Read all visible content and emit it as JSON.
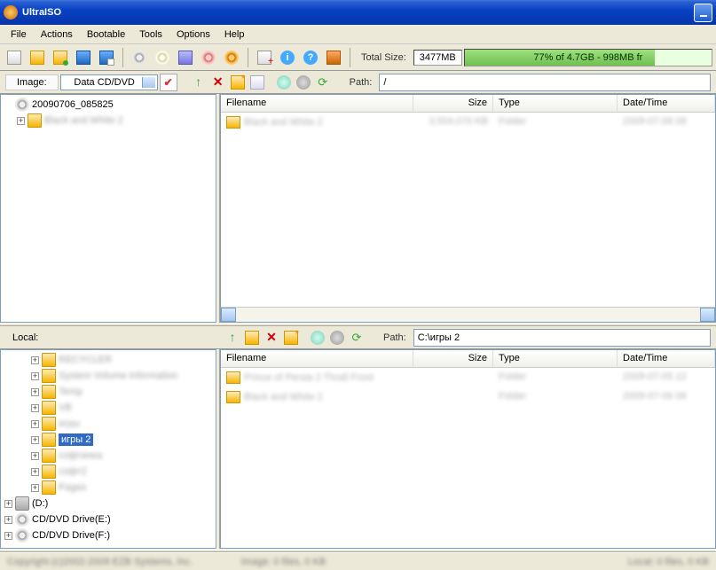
{
  "titlebar": {
    "title": "UltraISO"
  },
  "menubar": {
    "items": [
      "File",
      "Actions",
      "Bootable",
      "Tools",
      "Options",
      "Help"
    ]
  },
  "toolbar": {
    "total_size_label": "Total Size:",
    "total_size_value": "3477MB",
    "capacity_text": "77% of 4.7GB - 998MB fr",
    "capacity_percent": 77
  },
  "image_bar": {
    "label": "Image:",
    "combo_value": "Data CD/DVD",
    "path_label": "Path:",
    "path_value": "/"
  },
  "image_tree": {
    "root": "20090706_085825",
    "child_blur": "Black and White 2"
  },
  "image_list": {
    "columns": [
      "Filename",
      "Size",
      "Type",
      "Date/Time"
    ],
    "rows": [
      {
        "name_blur": "Black and White 2",
        "size_blur": "3,554,070 KB",
        "type_blur": "Folder",
        "date_blur": "2009-07-06 08"
      }
    ]
  },
  "local_bar": {
    "label": "Local:",
    "path_label": "Path:",
    "path_value": "C:\\игры 2"
  },
  "local_tree": {
    "items_blur": [
      "RECYCLER",
      "System Volume Information",
      "Temp",
      "VB",
      "игры",
      "игры 2",
      "софтинка",
      "софт2",
      "Pages"
    ],
    "selected_index": 5,
    "drives": [
      "(D:)",
      "CD/DVD Drive(E:)",
      "CD/DVD Drive(F:)"
    ]
  },
  "local_list": {
    "columns": [
      "Filename",
      "Size",
      "Type",
      "Date/Time"
    ],
    "rows": [
      {
        "name_blur": "Prince of Persia 2 Thrall Front",
        "size_blur": "",
        "type_blur": "Folder",
        "date_blur": "2009-07-05 12"
      },
      {
        "name_blur": "Black and White 2",
        "size_blur": "",
        "type_blur": "Folder",
        "date_blur": "2009-07-06 08"
      }
    ]
  },
  "statusbar": {
    "copyright": "Copyright (c)2002-2009 EZB Systems, Inc.",
    "image_status": "Image: 0 files, 0 KB",
    "local_status": "Local: 0 files, 0 KB"
  }
}
